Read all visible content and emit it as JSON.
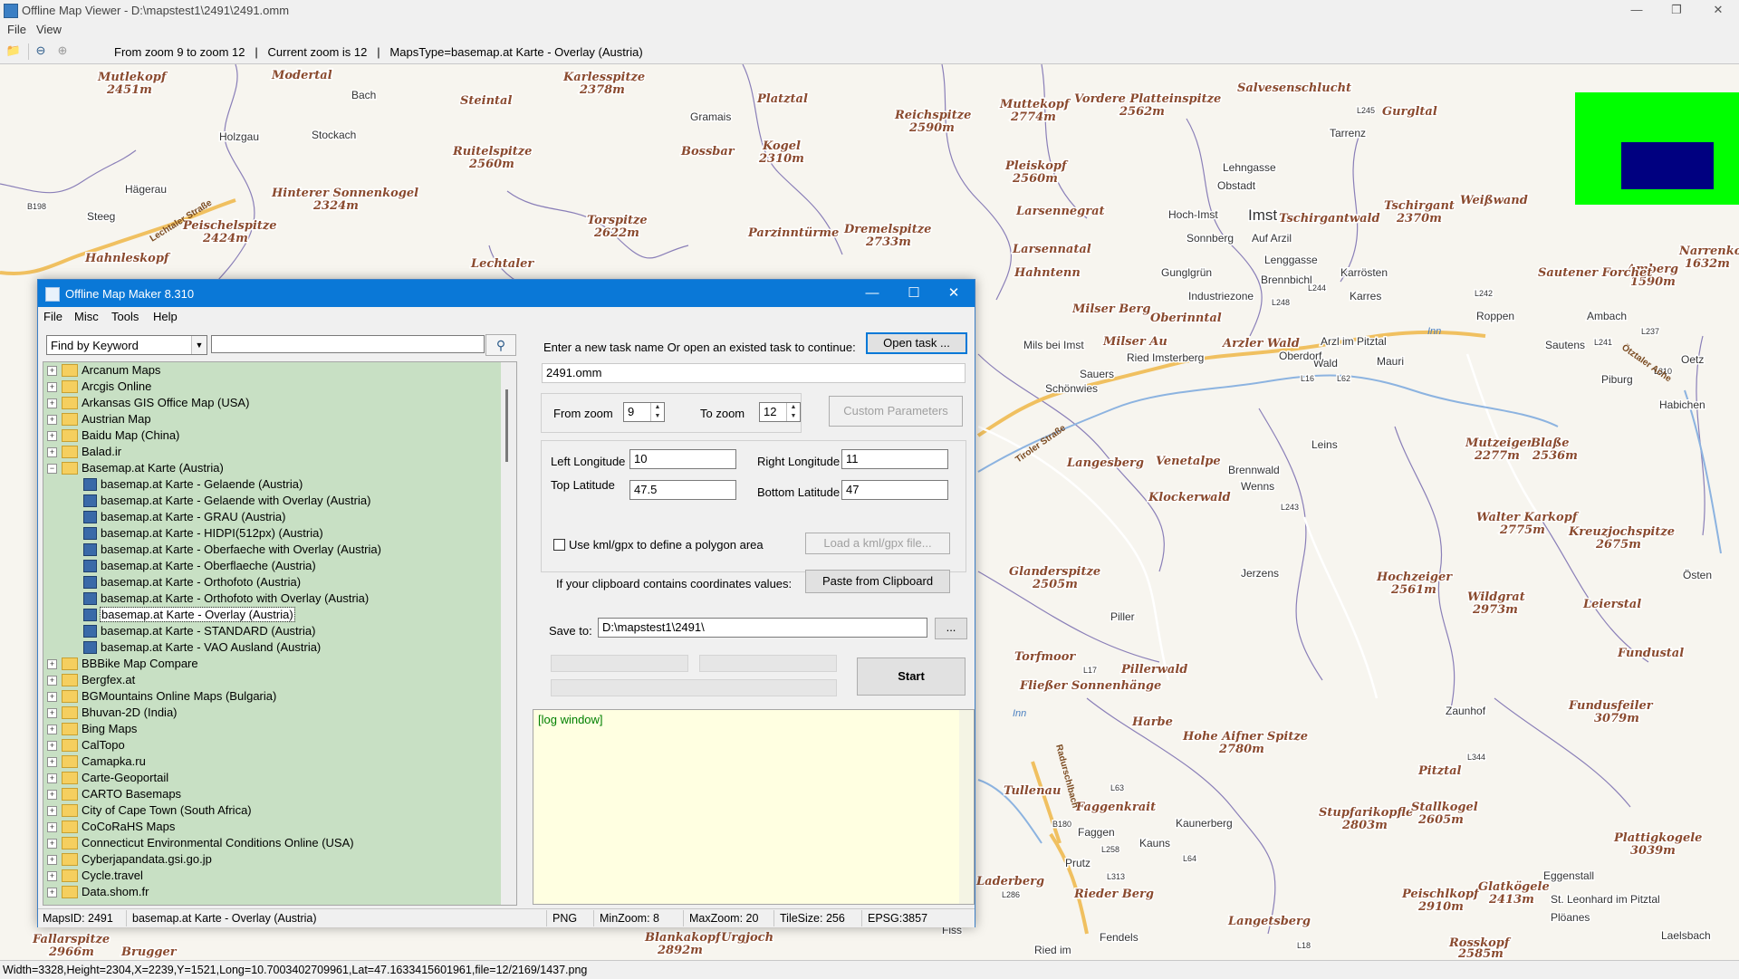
{
  "window": {
    "title": "Offline Map Viewer - D:\\mapstest1\\2491\\2491.omm",
    "menu": [
      "File",
      "View"
    ],
    "status_text": "From zoom 9 to zoom 12   |   Current zoom is 12   |   MapsType=basemap.at Karte - Overlay (Austria)",
    "bottom_status": "Width=3328,Height=2304,X=2239,Y=1521,Long=10.7003402709961,Lat=47.1633415601961,file=12/2169/1437.png"
  },
  "map": {
    "peaks": [
      {
        "name": "Mutlekopf",
        "elev": "2451m"
      },
      {
        "name": "Modertal"
      },
      {
        "name": "Karlesspitze",
        "elev": "2378m"
      },
      {
        "name": "Platztal"
      },
      {
        "name": "Reichspitze",
        "elev": "2590m"
      },
      {
        "name": "Muttekopf",
        "elev": "2774m"
      },
      {
        "name": "Vordere Platteinspitze",
        "elev": "2562m"
      },
      {
        "name": "Steintal"
      },
      {
        "name": "Ruitelspitze",
        "elev": "2560m"
      },
      {
        "name": "Kogel",
        "elev": "2310m"
      },
      {
        "name": "Bossbar"
      },
      {
        "name": "Hinterer Sonnenkogel",
        "elev": "2324m"
      },
      {
        "name": "Peischelspitze",
        "elev": "2424m"
      },
      {
        "name": "Torspitze",
        "elev": "2622m"
      },
      {
        "name": "Dremelspitze",
        "elev": "2733m"
      },
      {
        "name": "Parzinntürme"
      },
      {
        "name": "Hahnleskopf"
      },
      {
        "name": "Lechtaler"
      },
      {
        "name": "Pleiskopf",
        "elev": "2560m"
      },
      {
        "name": "Larsennegrat"
      },
      {
        "name": "Larsennatal"
      },
      {
        "name": "Tschirgant",
        "elev": "2370m"
      },
      {
        "name": "Tschirgantwald"
      },
      {
        "name": "Weißwand"
      },
      {
        "name": "Salvesenschlucht"
      },
      {
        "name": "Gurgltal"
      },
      {
        "name": "Amberg",
        "elev": "1590m"
      },
      {
        "name": "Narrenkopf",
        "elev": "1632m"
      },
      {
        "name": "Sautener Forchet"
      },
      {
        "name": "Hahntenn"
      },
      {
        "name": "Milser Berg"
      },
      {
        "name": "Oberinntal"
      },
      {
        "name": "Milser Au"
      },
      {
        "name": "Arzler Wald"
      },
      {
        "name": "Mutzeiger",
        "elev": "2277m"
      },
      {
        "name": "Blaße",
        "elev": "2536m"
      },
      {
        "name": "Langesberg"
      },
      {
        "name": "Venetalpe"
      },
      {
        "name": "Klockerwald"
      },
      {
        "name": "Walter Karkopf",
        "elev": "2775m"
      },
      {
        "name": "Kreuzjochspitze",
        "elev": "2675m"
      },
      {
        "name": "Glanderspitze",
        "elev": "2505m"
      },
      {
        "name": "Hochzeiger",
        "elev": "2561m"
      },
      {
        "name": "Wildgrat",
        "elev": "2973m"
      },
      {
        "name": "Leierstal"
      },
      {
        "name": "Torfmoor"
      },
      {
        "name": "Fließer Sonnenhänge"
      },
      {
        "name": "Pillerwald"
      },
      {
        "name": "Fundustal"
      },
      {
        "name": "Harbe"
      },
      {
        "name": "Hohe Aifner Spitze",
        "elev": "2780m"
      },
      {
        "name": "Fundusfeiler",
        "elev": "3079m"
      },
      {
        "name": "Pitztal"
      },
      {
        "name": "Tullenau"
      },
      {
        "name": "Faggenkrait"
      },
      {
        "name": "Stupfarikopfle",
        "elev": "2803m"
      },
      {
        "name": "Stallkogel",
        "elev": "2605m"
      },
      {
        "name": "Plattigkogele",
        "elev": "3039m"
      },
      {
        "name": "Laderberg"
      },
      {
        "name": "Rieder Berg"
      },
      {
        "name": "Peischlkopf",
        "elev": "2910m"
      },
      {
        "name": "Glatkögele",
        "elev": "2413m"
      },
      {
        "name": "Langetsberg"
      },
      {
        "name": "Fallarspitze",
        "elev": "2966m"
      },
      {
        "name": "Blankakopf",
        "elev": "2892m"
      },
      {
        "name": "Brugger"
      },
      {
        "name": "Urgjoch"
      },
      {
        "name": "Rosskopf",
        "elev": "2585m"
      }
    ],
    "towns": [
      "Bach",
      "Holzgau",
      "Stockach",
      "Steeg",
      "Hägerau",
      "Gramais",
      "Imst",
      "Hoch-Imst",
      "Obstadt",
      "Tarrenz",
      "Sonnberg",
      "Lenggasse",
      "Karrösten",
      "Karres",
      "Roppen",
      "Mils bei Imst",
      "Arzl im Pitztal",
      "Wald",
      "Imsterberg",
      "Leins",
      "Wenns",
      "Jerzens",
      "Piller",
      "Zaunhof",
      "Kaunerberg",
      "Prutz",
      "Faggen",
      "Kauns",
      "Ried im",
      "Fendels",
      "Fiss",
      "Sautens",
      "Oetz",
      "Piburg",
      "Habichen",
      "Östen",
      "Eggenstall",
      "St. Leonhard im Pitztal",
      "Plöanes",
      "Laelsbach",
      "Sauers",
      "Schönwies",
      "Brennwald",
      "Ried",
      "Oberdorf",
      "Mauri",
      "Ambach",
      "Gunglgrün",
      "Industriezone",
      "Auf Arzil",
      "Brennbichl",
      "Lehngasse"
    ],
    "roads": [
      "B198",
      "L245",
      "L248",
      "L244",
      "L242",
      "L241",
      "L237",
      "L310",
      "L16",
      "L62",
      "L243",
      "L17",
      "L344",
      "L63",
      "B180",
      "L258",
      "L313",
      "L286",
      "L64",
      "L18"
    ],
    "waters": [
      "Inn",
      "Ötztaler Ache",
      "Lechtaler Straße",
      "Tiroler Straße",
      "Radurschlbach"
    ],
    "overview_colors": {
      "bg": "#00ff00",
      "viewport": "#000080"
    }
  },
  "dialog": {
    "title": "Offline Map Maker 8.310",
    "menu": [
      "File",
      "Misc",
      "Tools",
      "Help"
    ],
    "find_mode": "Find by Keyword",
    "search_value": "",
    "tree": [
      {
        "label": "Arcanum Maps",
        "type": "folder",
        "open": false
      },
      {
        "label": "Arcgis Online",
        "type": "folder",
        "open": false
      },
      {
        "label": "Arkansas GIS Office Map (USA)",
        "type": "folder",
        "open": false
      },
      {
        "label": "Austrian Map",
        "type": "folder",
        "open": false
      },
      {
        "label": "Baidu Map (China)",
        "type": "folder",
        "open": false
      },
      {
        "label": "Balad.ir",
        "type": "folder",
        "open": false
      },
      {
        "label": "Basemap.at Karte (Austria)",
        "type": "folder",
        "open": true
      },
      {
        "label": "basemap.at Karte - Gelaende (Austria)",
        "type": "map"
      },
      {
        "label": "basemap.at Karte - Gelaende with Overlay (Austria)",
        "type": "map"
      },
      {
        "label": "basemap.at Karte - GRAU (Austria)",
        "type": "map"
      },
      {
        "label": "basemap.at Karte - HIDPI(512px) (Austria)",
        "type": "map"
      },
      {
        "label": "basemap.at Karte - Oberfaeche with Overlay (Austria)",
        "type": "map"
      },
      {
        "label": "basemap.at Karte - Oberflaeche (Austria)",
        "type": "map"
      },
      {
        "label": "basemap.at Karte - Orthofoto (Austria)",
        "type": "map"
      },
      {
        "label": "basemap.at Karte - Orthofoto with Overlay (Austria)",
        "type": "map"
      },
      {
        "label": "basemap.at Karte - Overlay (Austria)",
        "type": "map",
        "selected": true
      },
      {
        "label": "basemap.at Karte - STANDARD (Austria)",
        "type": "map"
      },
      {
        "label": "basemap.at Karte - VAO Ausland (Austria)",
        "type": "map"
      },
      {
        "label": "BBBike Map Compare",
        "type": "folder",
        "open": false
      },
      {
        "label": "Bergfex.at",
        "type": "folder",
        "open": false
      },
      {
        "label": "BGMountains Online Maps (Bulgaria)",
        "type": "folder",
        "open": false
      },
      {
        "label": "Bhuvan-2D (India)",
        "type": "folder",
        "open": false
      },
      {
        "label": "Bing Maps",
        "type": "folder",
        "open": false
      },
      {
        "label": "CalTopo",
        "type": "folder",
        "open": false
      },
      {
        "label": "Camapka.ru",
        "type": "folder",
        "open": false
      },
      {
        "label": "Carte-Geoportail",
        "type": "folder",
        "open": false
      },
      {
        "label": "CARTO Basemaps",
        "type": "folder",
        "open": false
      },
      {
        "label": "City of Cape Town (South Africa)",
        "type": "folder",
        "open": false
      },
      {
        "label": "CoCoRaHS Maps",
        "type": "folder",
        "open": false
      },
      {
        "label": "Connecticut Environmental Conditions Online (USA)",
        "type": "folder",
        "open": false
      },
      {
        "label": "Cyberjapandata.gsi.go.jp",
        "type": "folder",
        "open": false
      },
      {
        "label": "Cycle.travel",
        "type": "folder",
        "open": false
      },
      {
        "label": "Data.shom.fr",
        "type": "folder",
        "open": false
      }
    ],
    "task_prompt": "Enter a new task name Or open an existed task to continue:",
    "open_task_label": "Open task ...",
    "task_name": "2491.omm",
    "from_zoom_label": "From zoom",
    "from_zoom": "9",
    "to_zoom_label": "To zoom",
    "to_zoom": "12",
    "custom_params_label": "Custom Parameters",
    "left_lon_label": "Left Longitude",
    "left_lon": "10",
    "right_lon_label": "Right Longitude",
    "right_lon": "11",
    "top_lat_label": "Top Latitude",
    "top_lat": "47.5",
    "bottom_lat_label": "Bottom Latitude",
    "bottom_lat": "47",
    "kml_label": "Use kml/gpx to define a polygon area",
    "load_kml_label": "Load a kml/gpx file...",
    "clipboard_prompt": "If your clipboard contains coordinates values:",
    "paste_label": "Paste from Clipboard",
    "save_to_label": "Save to:",
    "save_to": "D:\\mapstest1\\2491\\",
    "browse_label": "...",
    "start_label": "Start",
    "log_label": "[log window]",
    "status": {
      "maps_id": "MapsID: 2491",
      "map_name": "basemap.at Karte - Overlay (Austria)",
      "format": "PNG",
      "min_zoom": "MinZoom: 8",
      "max_zoom": "MaxZoom: 20",
      "tile_size": "TileSize: 256",
      "epsg": "EPSG:3857"
    }
  }
}
